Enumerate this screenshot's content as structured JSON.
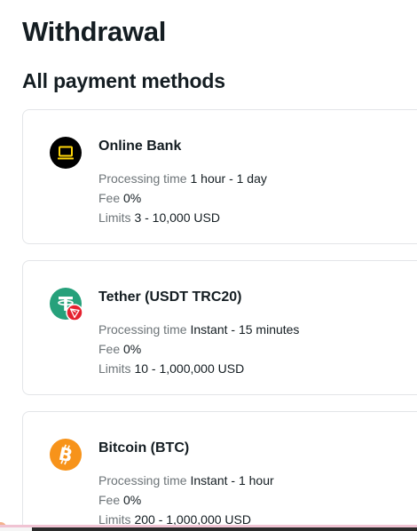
{
  "page_title": "Withdrawal",
  "section_title": "All payment methods",
  "methods": [
    {
      "name": "Online Bank",
      "icon": "laptop-icon",
      "processing_label": "Processing time",
      "processing_value": "1 hour - 1 day",
      "fee_label": "Fee",
      "fee_value": "0%",
      "limits_label": "Limits",
      "limits_value": "3 - 10,000 USD"
    },
    {
      "name": "Tether (USDT TRC20)",
      "icon": "tether-tron-icon",
      "processing_label": "Processing time",
      "processing_value": "Instant - 15 minutes",
      "fee_label": "Fee",
      "fee_value": "0%",
      "limits_label": "Limits",
      "limits_value": "10 - 1,000,000 USD"
    },
    {
      "name": "Bitcoin (BTC)",
      "icon": "bitcoin-icon",
      "processing_label": "Processing time",
      "processing_value": "Instant - 1 hour",
      "fee_label": "Fee",
      "fee_value": "0%",
      "limits_label": "Limits",
      "limits_value": "200 - 1,000,000 USD"
    }
  ],
  "colors": {
    "online_bank_icon_bg": "#000000",
    "online_bank_icon_fg": "#ffd60a",
    "tether_icon_bg": "#26a17b",
    "tron_badge_bg": "#e5212f",
    "bitcoin_icon_bg": "#f7931a"
  }
}
